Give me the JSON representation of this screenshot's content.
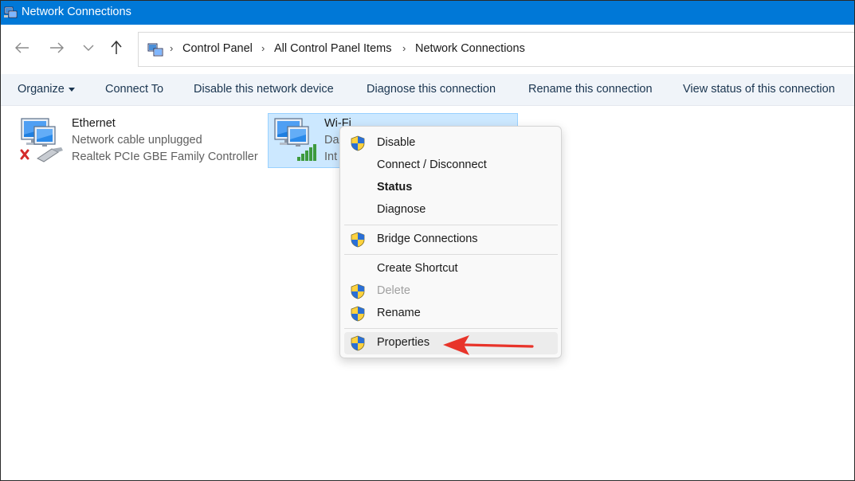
{
  "window": {
    "title": "Network Connections"
  },
  "breadcrumb": [
    "Control Panel",
    "All Control Panel Items",
    "Network Connections"
  ],
  "toolbar": {
    "organize": "Organize",
    "connect_to": "Connect To",
    "disable_device": "Disable this network device",
    "diagnose": "Diagnose this connection",
    "rename": "Rename this connection",
    "view_status": "View status of this connection"
  },
  "connections": {
    "ethernet": {
      "name": "Ethernet",
      "status": "Network cable unplugged",
      "device": "Realtek PCIe GBE Family Controller"
    },
    "wifi": {
      "name": "Wi-Fi",
      "status_partial": "Da",
      "device_partial": "Int"
    }
  },
  "context_menu": {
    "disable": "Disable",
    "connect_disconnect": "Connect / Disconnect",
    "status": "Status",
    "diagnose": "Diagnose",
    "bridge": "Bridge Connections",
    "create_shortcut": "Create Shortcut",
    "delete": "Delete",
    "rename": "Rename",
    "properties": "Properties"
  },
  "colors": {
    "titlebar": "#0078d7",
    "selection": "#cce8ff",
    "annotation_arrow": "#e8342a"
  },
  "icons": {
    "app": "network-connections-icon",
    "back": "back-arrow-icon",
    "forward": "forward-arrow-icon",
    "recent": "chevron-down-icon",
    "up": "up-arrow-icon",
    "shield": "uac-shield-icon"
  }
}
